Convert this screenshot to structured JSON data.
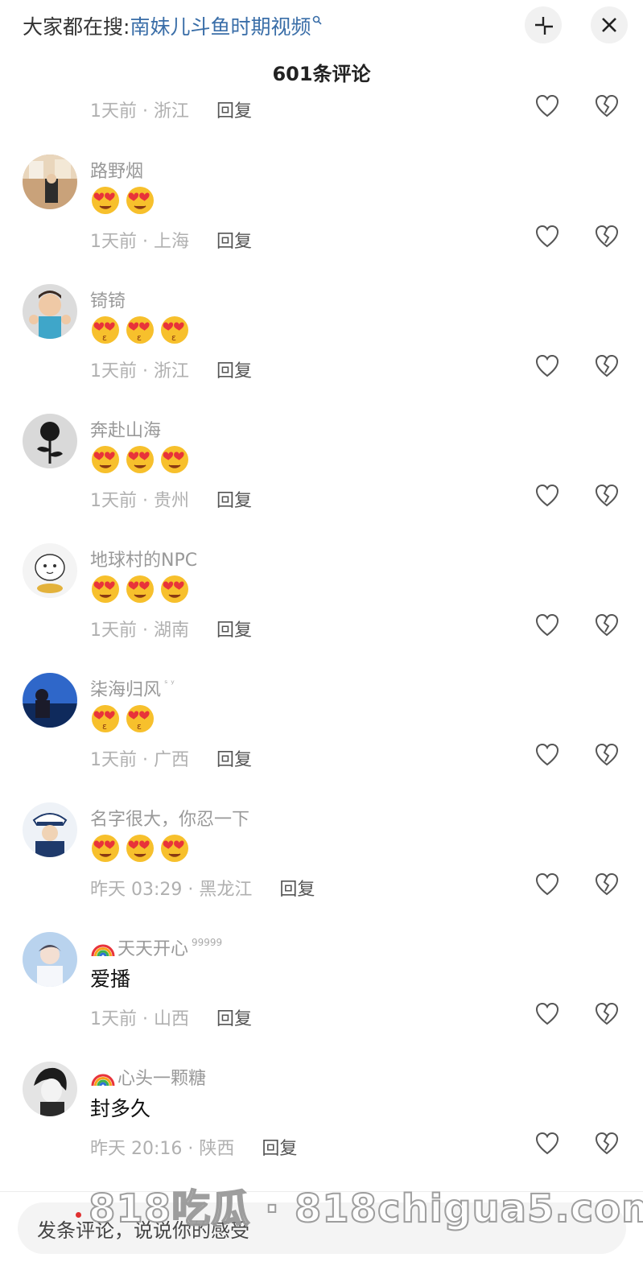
{
  "search_hint": {
    "prefix": "大家都在搜:",
    "query": "南妹儿斗鱼时期视频",
    "icon": "search-icon"
  },
  "header": {
    "title": "601条评论",
    "minimize_icon": "minimize-icon",
    "close_icon": "close-icon"
  },
  "partial_top_comment": {
    "meta": "1天前 · 浙江",
    "reply": "回复"
  },
  "comments": [
    {
      "nick": "路野烟",
      "emoji_count": 2,
      "text": "",
      "meta": "1天前 · 上海",
      "reply": "回复"
    },
    {
      "nick": "锜锜",
      "emoji_count": 3,
      "text": "",
      "meta": "1天前 · 浙江",
      "reply": "回复"
    },
    {
      "nick": "奔赴山海",
      "emoji_count": 3,
      "text": "",
      "meta": "1天前 · 贵州",
      "reply": "回复"
    },
    {
      "nick": "地球村的NPC",
      "emoji_count": 3,
      "text": "",
      "meta": "1天前 · 湖南",
      "reply": "回复"
    },
    {
      "nick": "柒海归风",
      "nick_sup": "ˢ ʸ",
      "emoji_count": 2,
      "text": "",
      "meta": "1天前 · 广西",
      "reply": "回复"
    },
    {
      "nick": "名字很大，你忍一下",
      "emoji_count": 3,
      "text": "",
      "meta": "昨天 03:29 · 黑龙江",
      "reply": "回复"
    },
    {
      "nick": "天天开心",
      "nick_sup": "99999",
      "rainbow": true,
      "emoji_count": 0,
      "text": "爱播",
      "meta": "1天前 · 山西",
      "reply": "回复"
    },
    {
      "nick": "心头一颗糖",
      "rainbow": true,
      "emoji_count": 0,
      "text": "封多久",
      "meta": "昨天 20:16 · 陕西",
      "reply": "回复"
    }
  ],
  "input": {
    "placeholder": "发条评论，说说你的感受"
  },
  "watermark": "818吃瓜 · 818chigua5.com",
  "colors": {
    "link": "#3a6ea8",
    "muted": "#999999",
    "reply": "#555555"
  }
}
